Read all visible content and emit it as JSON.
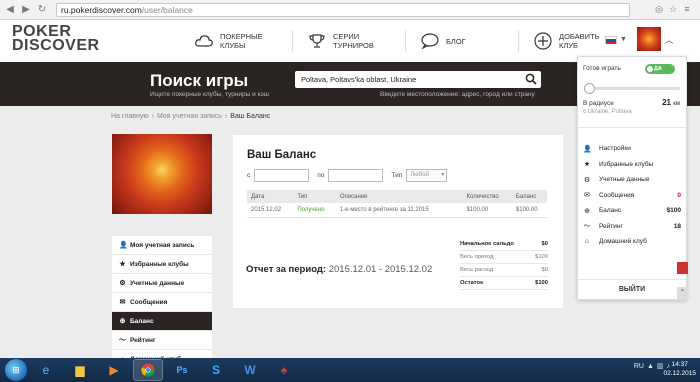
{
  "browser": {
    "url_host": "ru.pokerdiscover.com",
    "url_path": "/user/balance"
  },
  "header": {
    "logo_top": "POKER",
    "logo_bottom": "DISCOVER",
    "nav": [
      {
        "label": "ПОКЕРНЫЕ КЛУБЫ",
        "icon": "cloud-icon"
      },
      {
        "label": "СЕРИИ ТУРНИРОВ",
        "icon": "trophy-icon"
      },
      {
        "label": "БЛОГ",
        "icon": "chat-bubble-icon"
      },
      {
        "label": "ДОБАВИТЬ КЛУБ",
        "icon": "plus-circle-icon"
      }
    ]
  },
  "banner": {
    "title": "Поиск игры",
    "subtitle": "Ищите покерные клубы, турниры и кэш",
    "search_value": "Poltava, Poltavs'ka oblast, Ukraine",
    "hint": "Введите местоположение: адрес, город или страну"
  },
  "breadcrumb": [
    "На главную",
    "›",
    "Моя учетная запись",
    "›",
    "Ваш Баланс"
  ],
  "side_menu": [
    {
      "label": "Моя учетная запись",
      "icon": "user-icon",
      "active": false
    },
    {
      "label": "Избранные клубы",
      "icon": "star-icon",
      "active": false
    },
    {
      "label": "Учетные данные",
      "icon": "gear-icon",
      "active": false
    },
    {
      "label": "Сообщения",
      "icon": "envelope-icon",
      "active": false
    },
    {
      "label": "Баланс",
      "icon": "money-icon",
      "active": true
    },
    {
      "label": "Рейтинг",
      "icon": "chart-icon",
      "active": false
    },
    {
      "label": "Домашний клуб",
      "icon": "home-icon",
      "active": false
    }
  ],
  "content": {
    "title": "Ваш Баланс",
    "filter_from": "с",
    "filter_to": "по",
    "filter_type": "Тип",
    "filter_type_value": "Любой",
    "table_headers": [
      "Дата",
      "Тип",
      "Описание",
      "Количество",
      "Баланс"
    ],
    "rows": [
      [
        "2015.12.02",
        "Получено",
        "1-е место в рейтинге за 11.2015",
        "$100.00",
        "$100.00"
      ]
    ],
    "summary": [
      {
        "label": "Начальное сальдо",
        "value": "$0",
        "bold": true
      },
      {
        "label": "Весь приход",
        "value": "$100",
        "bold": false
      },
      {
        "label": "Весь расход",
        "value": "$0",
        "bold": false
      },
      {
        "label": "Остаток",
        "value": "$100",
        "bold": true
      }
    ],
    "report_label": "Отчет за период:",
    "report_range": "2015.12.01 - 2015.12.02"
  },
  "dropdown": {
    "ready_label": "Готов играть",
    "toggle_label": "ДА",
    "radius_label": "В радиусе",
    "radius_value": "21",
    "radius_unit": "км",
    "location": "с Ukraine, Poltava",
    "items": [
      {
        "label": "Настройки",
        "icon": "user-icon",
        "value": ""
      },
      {
        "label": "Избранные клубы",
        "icon": "star-icon",
        "value": ""
      },
      {
        "label": "Учетные данные",
        "icon": "gear-icon",
        "value": ""
      },
      {
        "label": "Сообщения",
        "icon": "envelope-icon",
        "value": "0",
        "red": true
      },
      {
        "label": "Баланс",
        "icon": "money-icon",
        "value": "$100"
      },
      {
        "label": "Рейтинг",
        "icon": "chart-icon",
        "value": "18"
      },
      {
        "label": "Домашний клуб",
        "icon": "home-icon",
        "value": ""
      }
    ],
    "logout": "ВЫЙТИ"
  },
  "taskbar": {
    "time": "14:37",
    "date": "02.12.2015"
  }
}
